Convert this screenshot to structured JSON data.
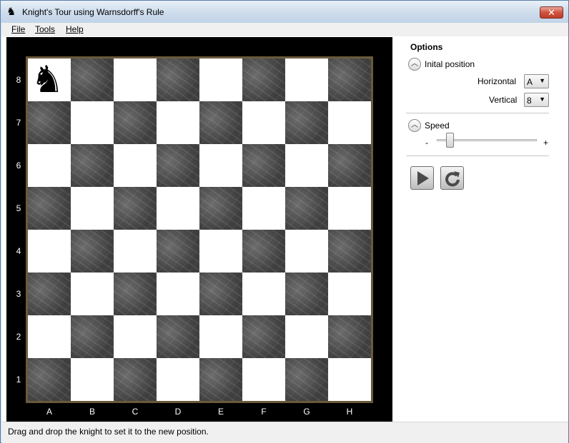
{
  "window": {
    "title": "Knight's Tour using Warnsdorff's Rule",
    "close_glyph": "✕",
    "app_icon": "knight-icon"
  },
  "menu": {
    "file": "File",
    "tools": "Tools",
    "help": "Help"
  },
  "board": {
    "ranks": [
      "8",
      "7",
      "6",
      "5",
      "4",
      "3",
      "2",
      "1"
    ],
    "files": [
      "A",
      "B",
      "C",
      "D",
      "E",
      "F",
      "G",
      "H"
    ],
    "knight_square": "A8",
    "knight_glyph": "♞",
    "light_color": "#ffffff",
    "dark_color": "#4a4a4a"
  },
  "options": {
    "title": "Options",
    "initial_position": {
      "label": "Inital position",
      "horizontal_label": "Horizontal",
      "horizontal_value": "A",
      "vertical_label": "Vertical",
      "vertical_value": "8"
    },
    "speed": {
      "label": "Speed",
      "min_label": "-",
      "max_label": "+",
      "level": 0.1
    },
    "buttons": {
      "play_icon": "play-icon",
      "reset_icon": "refresh-icon"
    }
  },
  "status": {
    "text": "Drag and drop the knight to set it to the new position."
  }
}
